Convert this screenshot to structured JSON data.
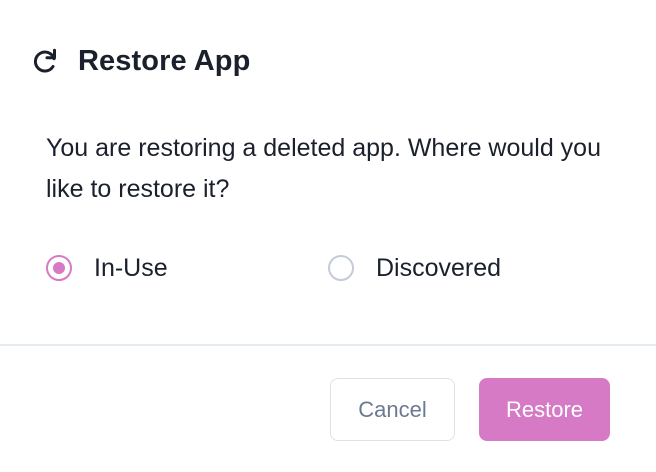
{
  "dialog": {
    "icon": "refresh-icon",
    "title": "Restore App",
    "message": "You are restoring a deleted app. Where would you like to restore it?",
    "options": [
      {
        "label": "In-Use",
        "checked": true
      },
      {
        "label": "Discovered",
        "checked": false
      }
    ],
    "buttons": {
      "cancel_label": "Cancel",
      "restore_label": "Restore"
    }
  },
  "colors": {
    "accent": "#d67ac6",
    "title_text": "#1a202c",
    "radio_unchecked": "#c3cbd9",
    "cancel_text": "#6b7a90",
    "divider": "#e4ebf1"
  }
}
